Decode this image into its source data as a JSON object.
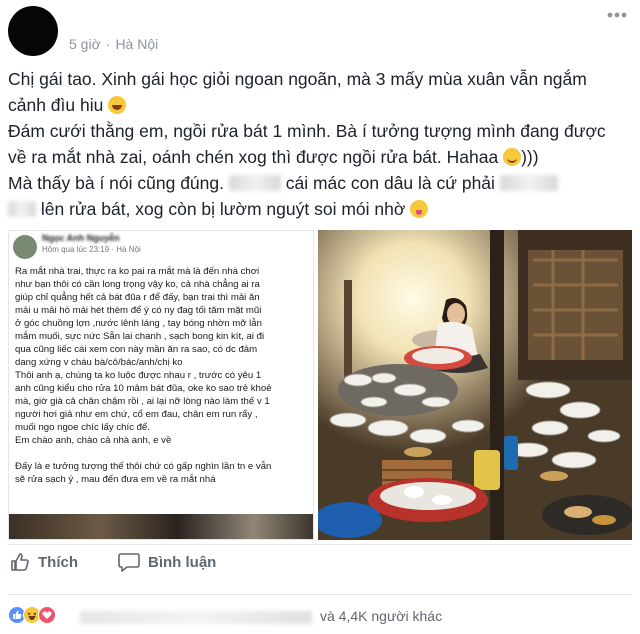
{
  "post": {
    "time": "5 giờ",
    "separator": "·",
    "location": "Hà Nội",
    "lines": [
      "Chị gái tao. Xinh gái học giỏi ngoan ngoãn, mà 3 mấy mùa xuân vẫn ngắm",
      "cảnh đìu hiu",
      "Đám cưới thằng em, ngồi rửa bát 1 mình. Bà í tưởng tượng mình đang được",
      "về ra mắt nhà zai, oánh chén xog thì được ngồi rửa bát. Hahaa",
      ")))",
      "Mà thấy bà í nói cũng đúng.",
      "cái mác con dâu là cứ phải",
      "lên rửa bát, xog còn bị lườm nguýt soi mói nhờ"
    ]
  },
  "screenshot": {
    "name": "Ngọc Anh Nguyễn",
    "time": "Hôm qua lúc 23:19 · Hà Nội",
    "body": "Ra mắt nhà trai, thực ra ko pai ra mắt mà là đến nhà chơi\nnhư bạn thôi có cần long trọng vậy ko, cả nhà chẳng ai ra\ngiúp chỉ quẳng hết cả bát đũa r để đấy, bạn trai thì mải ăn\nmải u mải hò mải hét    thèm để ý có ny đag tối tăm mặt mũi\nở góc chuồng lợn ,nước lênh láng  , tay bóng nhờn mỡ lẫn\nmắm muối, sực nức Sẵn lai chanh , sạch bong kin kít,  ai đi\nqua cũng liếc cái xem con này mần ăn ra sao, có dc đảm\ndang xứng v cháu bà/cô/bác/anh/chị ko\n Thôi anh ạ, chúng ta ko luộc được nhau r , trước có yêu 1\nanh cũng kiểu cho  rửa 10 mâm bát đũa, oke ko sao trẻ khoẻ\nmà, giờ già cả chân chậm rồi , ai lại nỡ lòng nào làm thế v 1\nngười hơi   giả  như em chứ, cổ em đau, chân em run rẩy ,\nmuối ngo ngoe chíc lấy chíc để.\n Em chào anh, chào cả   nhà anh, e về\n\nĐấy là e tưởng tượng thế thôi chứ có gấp nghìn lần tn e vẫn\nsẽ rửa sạch ý , mau đến đưa em về ra mắt nhá"
  },
  "actions": {
    "like_label": "Thích",
    "comment_label": "Bình luận"
  },
  "reactions": {
    "others_text": "và 4,4K người khác",
    "types": [
      "like",
      "haha",
      "love"
    ]
  },
  "colors": {
    "text": "#1d2129",
    "meta": "#90949c",
    "action": "#606770",
    "like_blue": "#5890ff",
    "love_red": "#f25268",
    "haha_yellow": "#f7c73c"
  },
  "icons": [
    "more-options-icon",
    "laugh-emoji-icon",
    "smile-emoji-icon",
    "tongue-emoji-icon",
    "like-icon",
    "comment-icon",
    "like-reaction-icon",
    "haha-reaction-icon",
    "love-reaction-icon"
  ]
}
